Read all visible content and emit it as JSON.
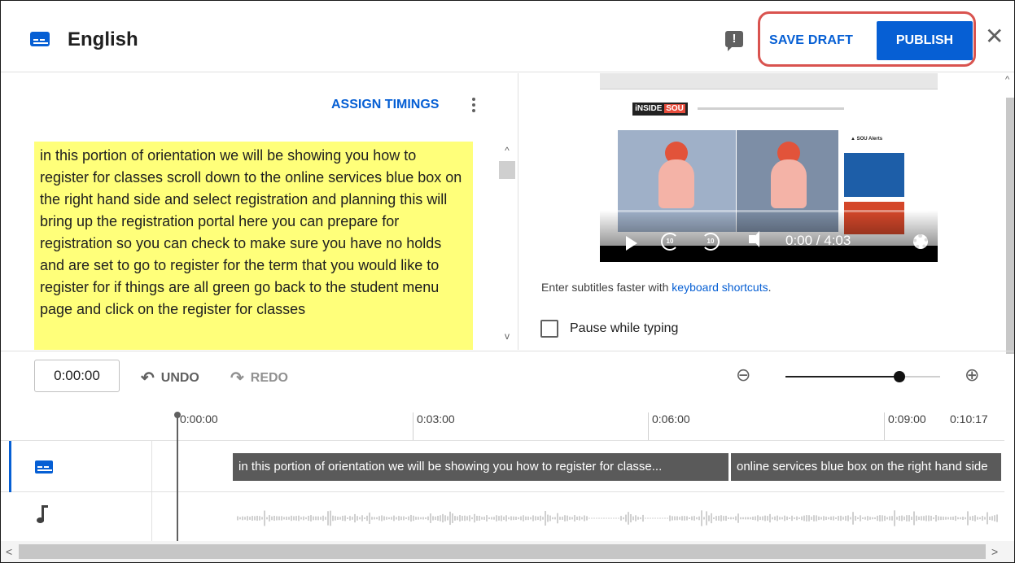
{
  "header": {
    "title": "English",
    "save_draft": "SAVE DRAFT",
    "publish": "PUBLISH",
    "feedback_symbol": "!",
    "close_symbol": "✕"
  },
  "editor": {
    "assign_timings": "ASSIGN TIMINGS",
    "transcript": "in this portion of orientation we will be showing you how to register for classes scroll down to the online services blue box on the right hand side and select registration and planning this will bring up the registration portal here you can prepare for registration so you can check to make sure you have no holds and are set to go to register for the term that you would like to register for if things are all green go back to the student menu page and click on the register for classes"
  },
  "video": {
    "time": "0:00 / 4:03",
    "logo_prefix": "iNSIDE",
    "logo_suffix": "SOU",
    "alerts": "▲ SOU Alerts"
  },
  "right_panel": {
    "hint_prefix": "Enter subtitles faster with ",
    "hint_link": "keyboard shortcuts",
    "hint_suffix": ".",
    "pause_label": "Pause while typing"
  },
  "toolbar": {
    "time_value": "0:00:00",
    "undo": "UNDO",
    "redo": "REDO",
    "zoom_out_symbol": "⊖",
    "zoom_in_symbol": "⊕",
    "zoom_level": 0.74
  },
  "timeline": {
    "ticks": [
      "0:00:00",
      "0:03:00",
      "0:06:00",
      "0:09:00",
      "0:10:17"
    ],
    "cues": [
      "in this portion of orientation we will be showing  you how to register for classe...",
      "online services blue box on the right hand  side"
    ]
  },
  "colors": {
    "accent": "#065fd4",
    "highlight": "#ffff7a",
    "ring": "#d9534f"
  },
  "icons": [
    "captions-icon",
    "feedback-icon",
    "close-icon",
    "more-vert-icon",
    "undo-icon",
    "redo-icon",
    "zoom-out-icon",
    "zoom-in-icon",
    "music-note-icon",
    "play-icon",
    "rewind-10-icon",
    "forward-10-icon",
    "volume-icon",
    "gear-icon"
  ]
}
